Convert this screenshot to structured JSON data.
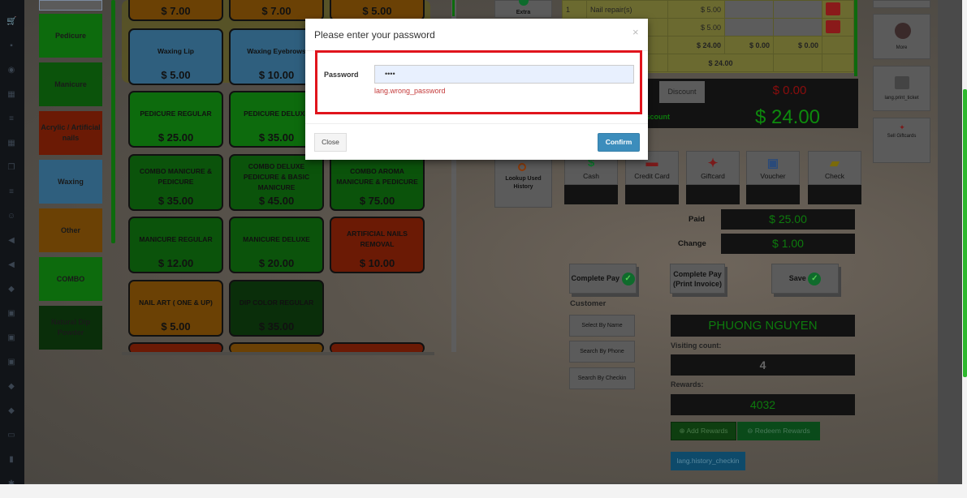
{
  "sidebar": {
    "icons": [
      "cart-icon",
      "briefcase-icon",
      "eye-icon",
      "calendar-icon",
      "list-icon",
      "calendar-icon",
      "copy-icon",
      "list-icon",
      "smile-icon",
      "bullhorn-icon",
      "bullhorn-icon",
      "tag-icon",
      "gift-icon",
      "gift-icon",
      "gift-icon",
      "ticket-icon",
      "ticket-icon",
      "money-icon",
      "bookmark-icon",
      "gear-icon"
    ]
  },
  "categories": [
    {
      "label": "Pedicure",
      "color": "#0d6b0d"
    },
    {
      "label": "Manicure",
      "color": "#0b530b"
    },
    {
      "label": "Acrylic / Artificial nails",
      "color": "#6b1a05"
    },
    {
      "label": "Waxing",
      "color": "#2f5f7e"
    },
    {
      "label": "Other",
      "color": "#6b4105"
    },
    {
      "label": "COMBO",
      "color": "#0d6b0d"
    },
    {
      "label": "Natural Dip Powder",
      "color": "#0a2e0a"
    }
  ],
  "services": [
    {
      "name": "",
      "price": "$ 7.00",
      "style": "o"
    },
    {
      "name": "",
      "price": "$ 7.00",
      "style": "o"
    },
    {
      "name": "",
      "price": "$ 5.00",
      "style": "o"
    },
    {
      "name": "Waxing Lip",
      "price": "$ 5.00",
      "style": "b"
    },
    {
      "name": "Waxing Eyebrows",
      "price": "$ 10.00",
      "style": "b"
    },
    {
      "name": "PEDICURE REGULAR",
      "price": "$ 25.00",
      "style": "g"
    },
    {
      "name": "PEDICURE DELUXE",
      "price": "$ 35.00",
      "style": "g"
    },
    {
      "name": "PEDICURE AROME",
      "price": "$ 55.00",
      "style": "g"
    },
    {
      "name": "COMBO MANICURE & PEDICURE",
      "price": "$ 35.00",
      "style": "dg"
    },
    {
      "name": "COMBO DELUXE PEDICURE & BASIC MANICURE",
      "price": "$ 45.00",
      "style": "dg"
    },
    {
      "name": "COMBO AROMA MANICURE & PEDICURE",
      "price": "$ 75.00",
      "style": "dg"
    },
    {
      "name": "MANICURE REGULAR",
      "price": "$ 12.00",
      "style": "dg"
    },
    {
      "name": "MANICURE DELUXE",
      "price": "$ 20.00",
      "style": "dg"
    },
    {
      "name": "ARTIFICIAL NAILS REMOVAL",
      "price": "$ 10.00",
      "style": "r"
    },
    {
      "name": "NAIL ART ( ONE & UP)",
      "price": "$ 5.00",
      "style": "o"
    },
    {
      "name": "DIP COLOR REGULAR",
      "price": "$ 35.00",
      "style": "vdg"
    }
  ],
  "actions": {
    "extra": "Extra",
    "lookup": "Lookup Used History"
  },
  "ticket": {
    "rows": [
      {
        "qty": "1",
        "name": "Nail repair(s)",
        "price": "$ 5.00"
      },
      {
        "qty": "",
        "name": "",
        "price": "$ 5.00"
      }
    ],
    "subtotal": "$ 24.00",
    "tip": "$ 0.00",
    "tax": "$ 0.00",
    "total_label": "Total",
    "total": "$ 24.00"
  },
  "discount": {
    "button": "Discount",
    "amount": "$ 0.00",
    "after_label": "Total After Discount",
    "after": "$ 24.00"
  },
  "payments": [
    "Cash",
    "Credit Card",
    "Giftcard",
    "Voucher",
    "Check"
  ],
  "paid": {
    "label": "Paid",
    "value": "$ 25.00"
  },
  "change": {
    "label": "Change",
    "value": "$ 1.00"
  },
  "buttons": {
    "complete_pay": "Complete Pay",
    "complete_print": "Complete Pay (Print Invoice)",
    "save": "Save"
  },
  "customer": {
    "label": "Customer",
    "select_name": "Select By Name",
    "search_phone": "Search By Phone",
    "search_checkin": "Search By Checkin",
    "name": "PHUONG NGUYEN",
    "visiting_label": "Visiting count:",
    "visiting": "4",
    "rewards_label": "Rewards:",
    "rewards": "4032",
    "add_rewards": "Add Rewards",
    "redeem_rewards": "Redeem Rewards",
    "history": "lang.history_checkin"
  },
  "right": {
    "more": "More",
    "print": "lang.print_ticket",
    "sell": "Sell Giftcards"
  },
  "modal": {
    "title": "Please enter your password",
    "close_x": "×",
    "password_label": "Password",
    "password_value": "••••",
    "error": "lang.wrong_password",
    "close": "Close",
    "confirm": "Confirm",
    "highlight_color": "#e0141c",
    "confirm_color": "#3c8dbc"
  }
}
